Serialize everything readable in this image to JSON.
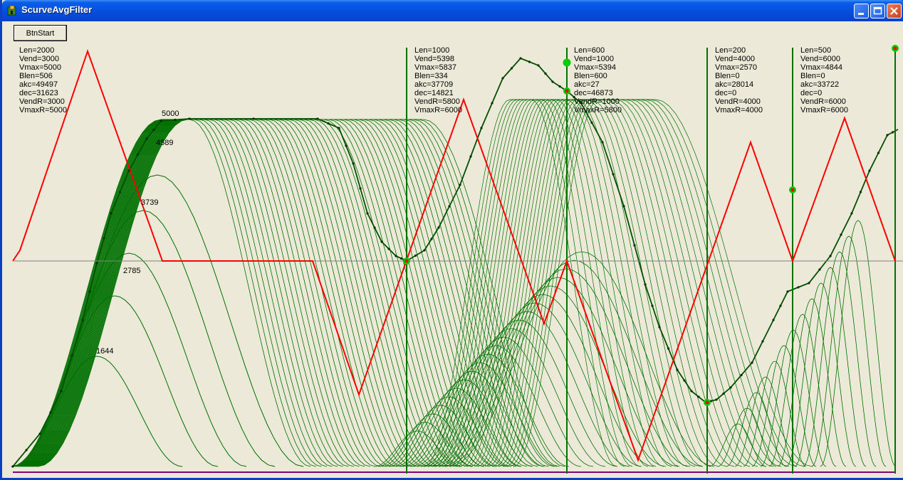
{
  "window": {
    "title": "ScurveAvgFilter"
  },
  "toolbar": {
    "start_label": "BtnStart"
  },
  "colors": {
    "filter_curves": "#007000",
    "velocity_profile": "#ff0000",
    "markers": "#00cc00",
    "baseline": "#800080"
  },
  "info_blocks": [
    {
      "lines": [
        "Len=2000",
        "Vend=3000",
        "Vmax=5000",
        "Blen=506",
        "akc=49497",
        "dec=31623",
        "VendR=3000",
        "VmaxR=5000"
      ]
    },
    {
      "lines": [
        "Len=1000",
        "Vend=5398",
        "Vmax=5837",
        "Blen=334",
        "akc=37709",
        "dec=14821",
        "VendR=5800",
        "VmaxR=6000"
      ]
    },
    {
      "lines": [
        "Len=600",
        "Vend=1000",
        "Vmax=5394",
        "Blen=600",
        "akc=27",
        "dec=46873",
        "VendR=1000",
        "VmaxR=5800"
      ]
    },
    {
      "lines": [
        "Len=200",
        "Vend=4000",
        "Vmax=2570",
        "Blen=0",
        "akc=28014",
        "dec=0",
        "VendR=4000",
        "VmaxR=4000"
      ]
    },
    {
      "lines": [
        "Len=500",
        "Vend=6000",
        "Vmax=4844",
        "Blen=0",
        "akc=33722",
        "dec=0",
        "VendR=6000",
        "VmaxR=6000"
      ]
    }
  ],
  "peak_labels": [
    "5000",
    "4589",
    "3739",
    "2785",
    "1644"
  ]
}
